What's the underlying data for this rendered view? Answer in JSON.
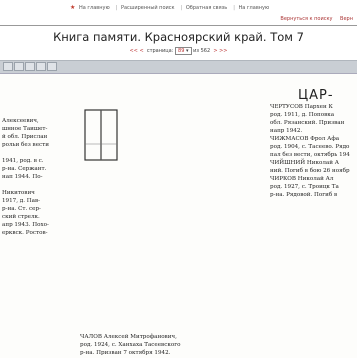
{
  "topnav": {
    "items": [
      "На главную",
      "Расширенный поиск",
      "Обратная связь",
      "На главную"
    ],
    "highlight_color": "#c0392b"
  },
  "secondnav": {
    "items": [
      "Вернуться к поиску",
      "Верн"
    ]
  },
  "title": "Книга памяти. Красноярский край. Том 7",
  "pager": {
    "left_arrows": "<< <",
    "label": "страница",
    "value": "89",
    "suffix": "из 562",
    "right_arrows": "> >>"
  },
  "scan": {
    "section_heading": "ЦАР-",
    "left_col": [
      "Алексеевич,",
      "шнное Таишет-",
      "й обл. Прислан",
      "рольи без вести",
      "",
      "1941, род. в с.",
      "р-на. Сержант.",
      "нап 1944. По-",
      "",
      "Никитович",
      "1917, д. Пав-",
      "р-на. Ст. сер-",
      "ский стрелк.",
      "апр 1943. Похо-",
      "ерквск. Ростов-"
    ],
    "center_col": [
      "ЧАЛОВ Алексей Митрофанович,",
      "род. 1924, с. Ханхаха Тасеевского",
      "р-на. Призван 7 октября 1942."
    ],
    "right_col": [
      "ЧЕРТУСОВ Пархен К",
      "род. 1911, д. Поповка",
      "обл. Рязанский. Призван",
      "напр 1942.",
      "ЧИЖМАСОВ Фрол Афа",
      "род. 1904, с. Тасеево. Рядо",
      "пал без вести, октябрь 194",
      "ЧИЙШНИЙ Николай А",
      "ний. Погиб в бою 26 ноябр",
      "ЧИРКОВ Николай Ал",
      "род. 1927, с. Троицк Та",
      "р-на. Рядовой. Погиб в"
    ]
  }
}
